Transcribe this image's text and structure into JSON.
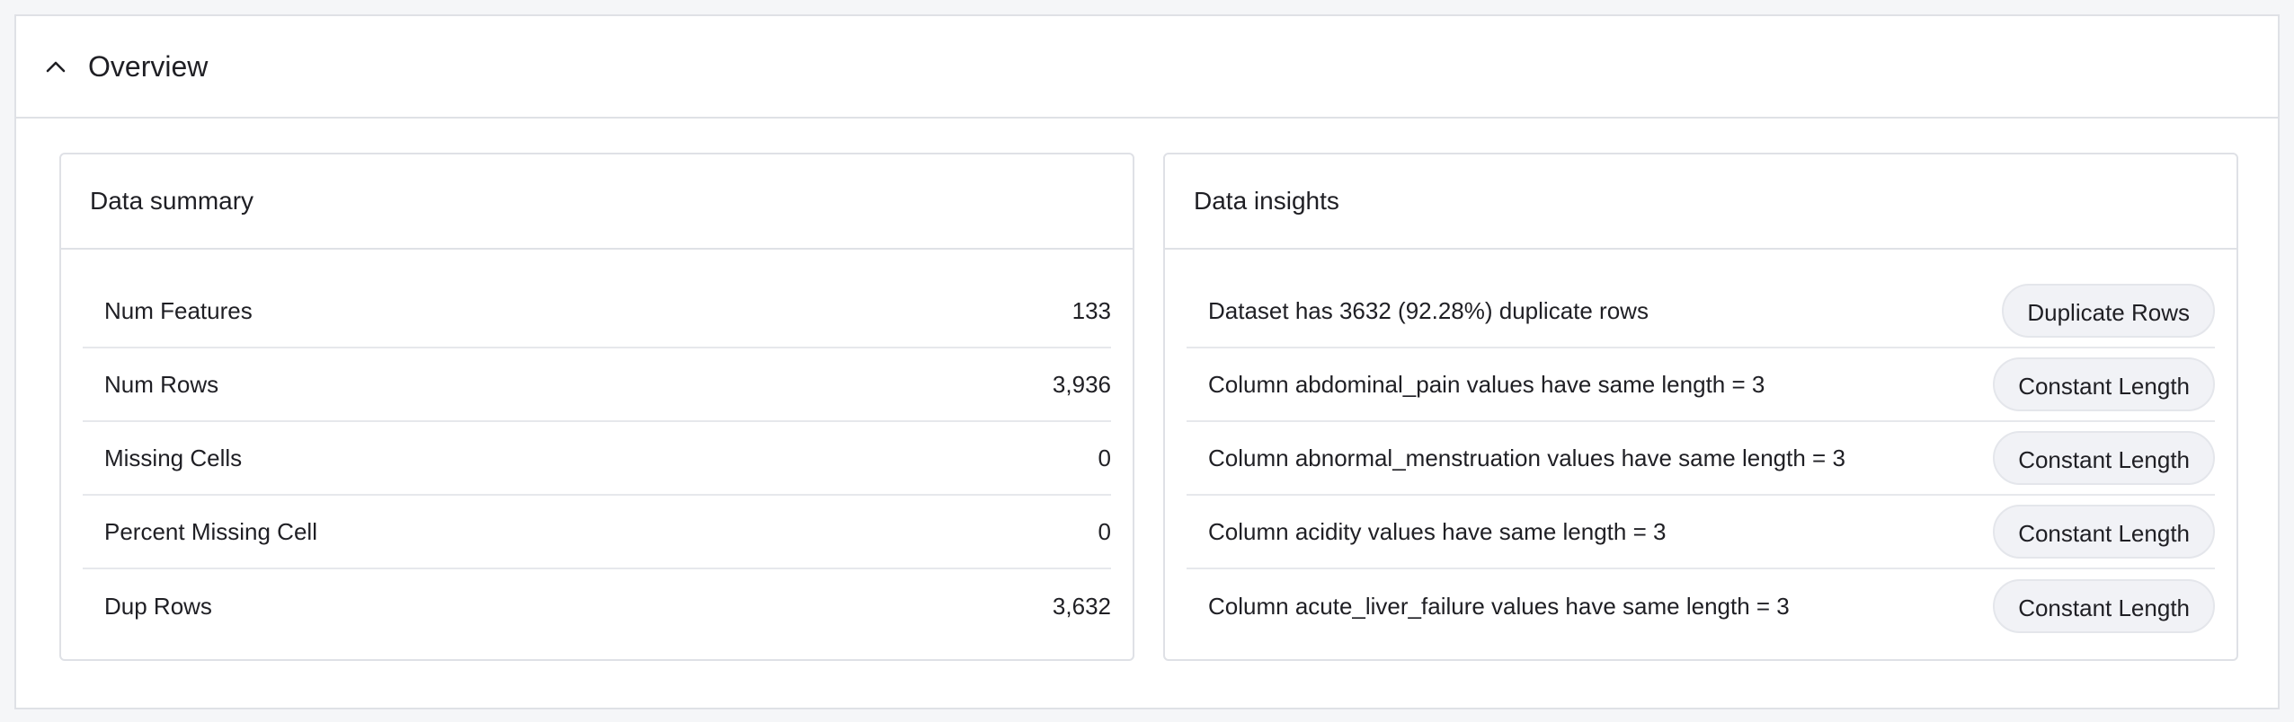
{
  "overview": {
    "title": "Overview"
  },
  "summary": {
    "title": "Data summary",
    "rows": [
      {
        "label": "Num Features",
        "value": "133"
      },
      {
        "label": "Num Rows",
        "value": "3,936"
      },
      {
        "label": "Missing Cells",
        "value": "0"
      },
      {
        "label": "Percent Missing Cell",
        "value": "0"
      },
      {
        "label": "Dup Rows",
        "value": "3,632"
      }
    ]
  },
  "insights": {
    "title": "Data insights",
    "rows": [
      {
        "text": "Dataset has 3632 (92.28%) duplicate rows",
        "tag": "Duplicate Rows"
      },
      {
        "text": "Column abdominal_pain values have same length = 3",
        "tag": "Constant Length"
      },
      {
        "text": "Column abnormal_menstruation values have same length = 3",
        "tag": "Constant Length"
      },
      {
        "text": "Column acidity values have same length = 3",
        "tag": "Constant Length"
      },
      {
        "text": "Column acute_liver_failure values have same length = 3",
        "tag": "Constant Length"
      }
    ]
  },
  "icons": {
    "collapse": "chevron-up-icon"
  }
}
